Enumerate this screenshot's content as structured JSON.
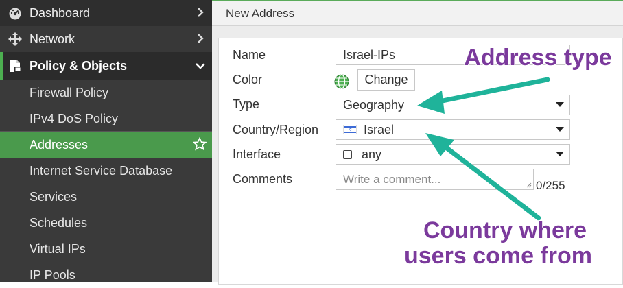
{
  "sidebar": {
    "top_items": [
      {
        "label": "Dashboard",
        "icon": "dashboard-icon"
      },
      {
        "label": "Network",
        "icon": "network-move-icon"
      }
    ],
    "section": {
      "label": "Policy & Objects",
      "icon": "policy-document-icon"
    },
    "sub_items": [
      {
        "label": "Firewall Policy"
      },
      {
        "label": "IPv4 DoS Policy"
      },
      {
        "label": "Addresses",
        "active": true
      },
      {
        "label": "Internet Service Database"
      },
      {
        "label": "Services"
      },
      {
        "label": "Schedules"
      },
      {
        "label": "Virtual IPs"
      },
      {
        "label": "IP Pools"
      }
    ]
  },
  "header": {
    "title": "New Address"
  },
  "form": {
    "name": {
      "label": "Name",
      "value": "Israel-IPs"
    },
    "color": {
      "label": "Color",
      "button": "Change",
      "swatch_color": "#4caf50"
    },
    "type": {
      "label": "Type",
      "value": "Geography"
    },
    "country": {
      "label": "Country/Region",
      "value": "Israel",
      "flag_icon": "israel-flag-icon"
    },
    "interface": {
      "label": "Interface",
      "value": "any"
    },
    "comments": {
      "label": "Comments",
      "placeholder": "Write a comment...",
      "counter": "0/255"
    }
  },
  "annotations": {
    "address_type": "Address type",
    "country_line1": "Country  where",
    "country_line2": "users come from",
    "color": "#7b3a9c",
    "arrow_color": "#1fb39a"
  },
  "colors": {
    "sidebar_bg": "#3a3a3a",
    "active_bg": "#4a9a4c",
    "accent": "#4caf50"
  }
}
